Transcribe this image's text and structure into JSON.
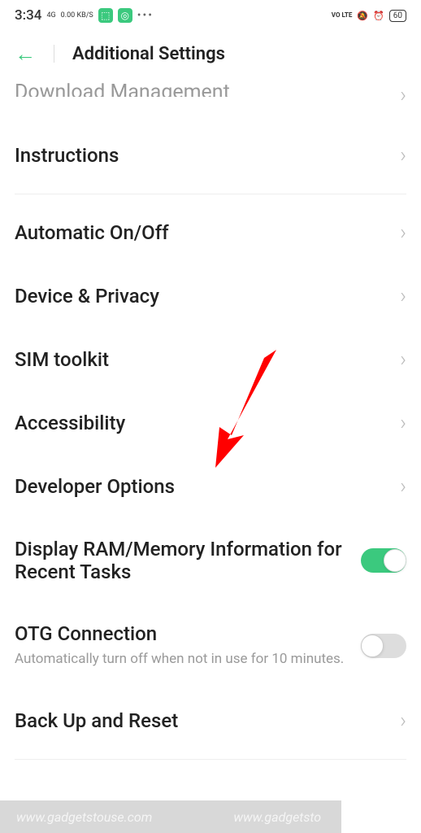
{
  "status": {
    "time": "3:34",
    "network": "4G",
    "speed": "0.00 KB/S",
    "volte": "VO LTE",
    "battery": "60"
  },
  "header": {
    "title": "Additional Settings"
  },
  "items": {
    "cutoff": "Download Management",
    "instructions": "Instructions",
    "auto_onoff": "Automatic On/Off",
    "device_privacy": "Device & Privacy",
    "sim_toolkit": "SIM toolkit",
    "accessibility": "Accessibility",
    "developer": "Developer Options",
    "ram_display": "Display RAM/Memory Information for Recent Tasks",
    "otg": "OTG Connection",
    "otg_desc": "Automatically turn off when not in use for 10 minutes.",
    "backup": "Back Up and Reset"
  },
  "watermark": "www.gadgetstouse.com",
  "watermark2": "www.gadgetsto"
}
